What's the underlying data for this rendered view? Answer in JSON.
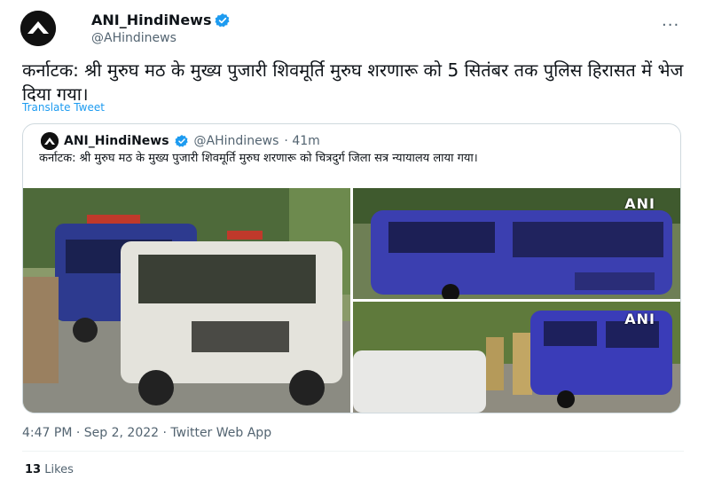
{
  "tweet": {
    "author": {
      "display_name": "ANI_HindiNews",
      "handle": "@AHindinews",
      "verified_icon": "verified-badge-icon",
      "avatar_logo_text": "ANI"
    },
    "more_icon": "more-horizontal-icon",
    "text": "कर्नाटक: श्री मुरुघ मठ के मुख्य पुजारी शिवमूर्ति मुरुघ शरणारू को 5 सितंबर तक पुलिस हिरासत में भेज दिया गया।",
    "translate_label": "Translate Tweet",
    "quoted": {
      "display_name": "ANI_HindiNews",
      "handle": "@AHindinews",
      "age": "· 41m",
      "text": "कर्नाटक: श्री मुरुघ मठ के मुख्य पुजारी शिवमूर्ति मुरुघ शरणारू को चित्रदुर्ग जिला सत्र न्यायालय लाया गया।",
      "watermarks": [
        "ANI",
        "ANI"
      ]
    },
    "timestamp": "4:47 PM · Sep 2, 2022 · Twitter Web App",
    "likes_count": "13",
    "likes_label": "Likes"
  },
  "colors": {
    "accent": "#1d9bf0",
    "secondary_text": "#536471",
    "border": "#cfd9de"
  }
}
